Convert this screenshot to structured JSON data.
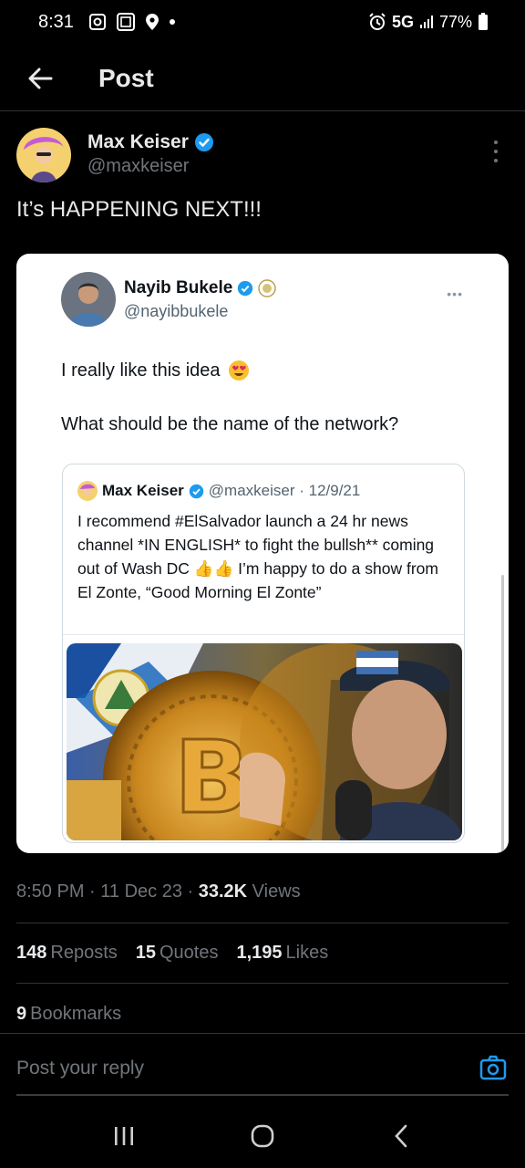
{
  "status_bar": {
    "time": "8:31",
    "network": "5G",
    "battery": "77%"
  },
  "header": {
    "title": "Post"
  },
  "post": {
    "author_name": "Max Keiser",
    "author_handle": "@maxkeiser",
    "text": "It’s HAPPENING NEXT!!!",
    "embedded": {
      "author_name": "Nayib Bukele",
      "author_handle": "@nayibbukele",
      "line1": "I really like this idea",
      "line2": "What should be the name of the network?",
      "quote": {
        "author_name": "Max Keiser",
        "meta": "@maxkeiser · 12/9/21",
        "text": "I recommend #ElSalvador launch a 24 hr news channel *IN ENGLISH* to fight the bullsh** coming out of Wash DC 👍👍 I’m happy to do a show from El Zonte, “Good Morning El Zonte”"
      }
    },
    "time": "8:50 PM",
    "date": "11 Dec 23",
    "views_count": "33.2K",
    "views_label": "Views",
    "reposts_count": "148",
    "reposts_label": "Reposts",
    "quotes_count": "15",
    "quotes_label": "Quotes",
    "likes_count": "1,195",
    "likes_label": "Likes",
    "bookmarks_count": "9",
    "bookmarks_label": "Bookmarks"
  },
  "reply": {
    "placeholder": "Post your reply"
  },
  "colors": {
    "accent": "#1d9bf0",
    "background": "#000000",
    "muted": "#71767b"
  }
}
